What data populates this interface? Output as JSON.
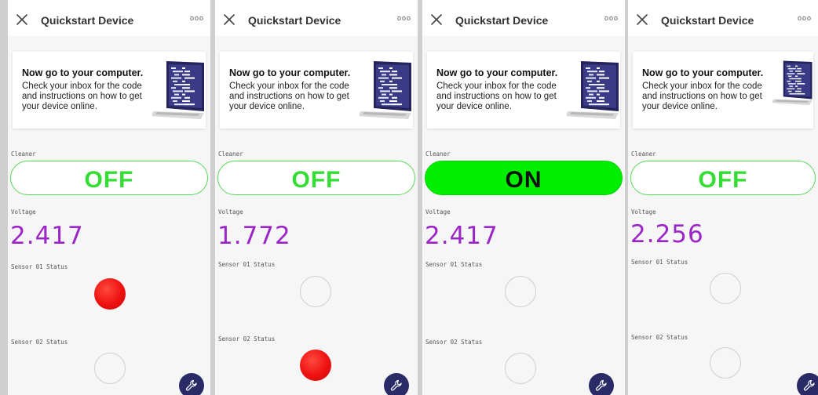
{
  "header": {
    "title": "Quickstart Device",
    "close_icon": "close-icon",
    "more_icon": "more-horizontal-icon",
    "more_glyph": "ooo"
  },
  "card": {
    "title": "Now go to your computer.",
    "body": "Check your inbox for the code and instructions on how to get your device online.",
    "image_icon": "laptop-code-icon"
  },
  "labels": {
    "cleaner": "Cleaner",
    "voltage": "Voltage",
    "sensor1": "Sensor 01 Status",
    "sensor2": "Sensor 02 Status"
  },
  "fab_icon": "wrench-icon",
  "colors": {
    "voltage": "#9b26c6",
    "toggle_on_bg": "#00ee00",
    "toggle_off_text": "#33dd33",
    "led_active": "#ee1111",
    "fab_bg": "#2a2a66"
  },
  "screens": [
    {
      "cleaner_state": "OFF",
      "cleaner_on": false,
      "voltage": "2.417",
      "sensor1_active": true,
      "sensor2_active": false
    },
    {
      "cleaner_state": "OFF",
      "cleaner_on": false,
      "voltage": "1.772",
      "sensor1_active": false,
      "sensor2_active": true
    },
    {
      "cleaner_state": "ON",
      "cleaner_on": true,
      "voltage": "2.417",
      "sensor1_active": false,
      "sensor2_active": false
    },
    {
      "cleaner_state": "OFF",
      "cleaner_on": false,
      "voltage": "2.256",
      "sensor1_active": false,
      "sensor2_active": false
    }
  ]
}
